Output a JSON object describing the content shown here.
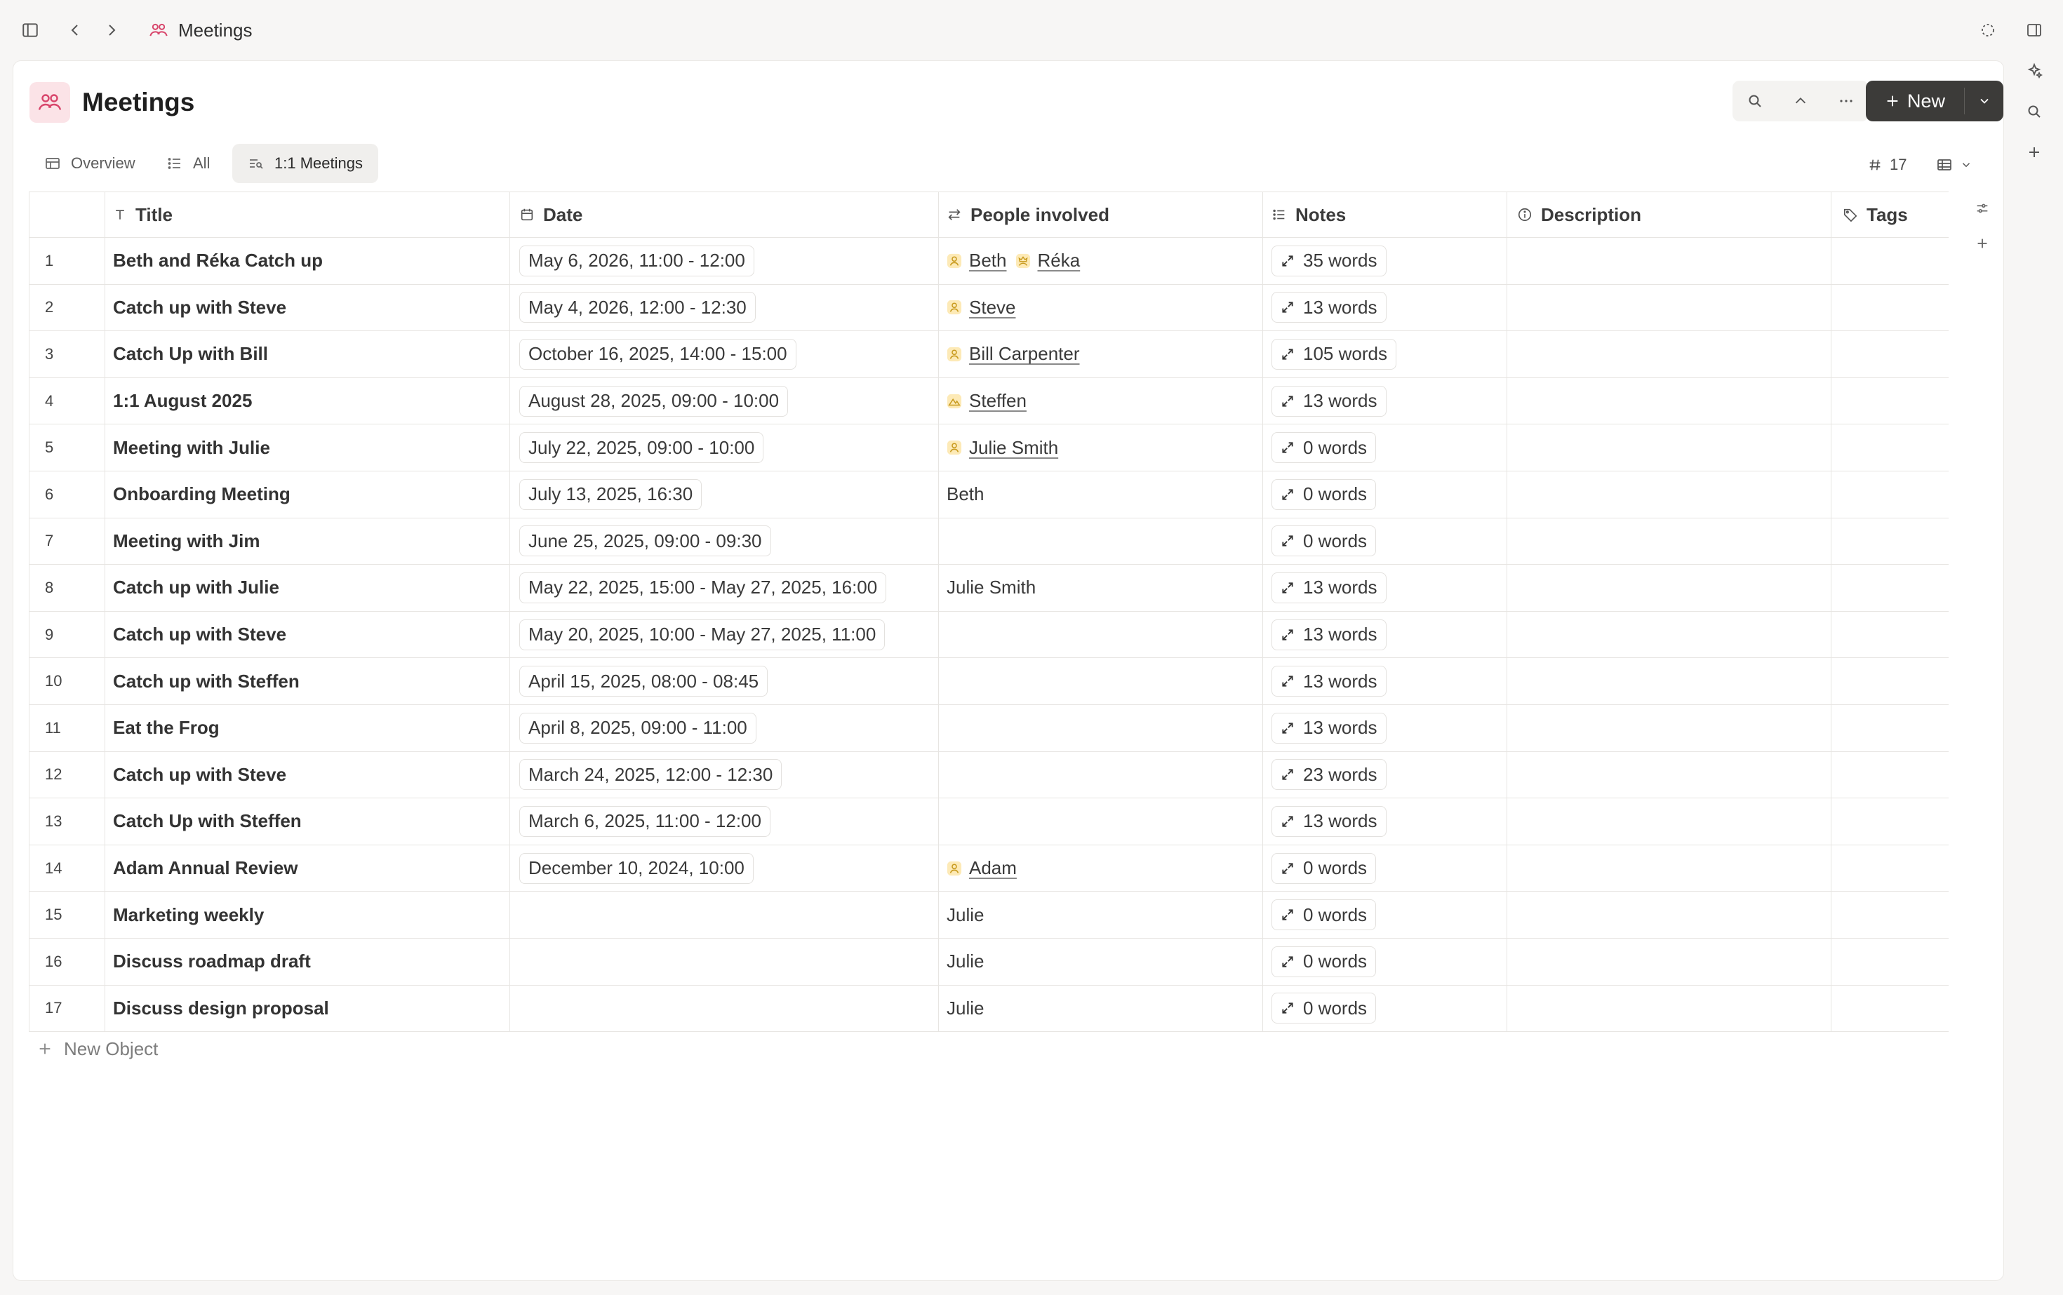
{
  "breadcrumb": {
    "title": "Meetings"
  },
  "header": {
    "title": "Meetings",
    "new_label": "New"
  },
  "tabs": [
    {
      "label": "Overview",
      "icon": "table-icon"
    },
    {
      "label": "All",
      "icon": "list-icon"
    },
    {
      "label": "1:1 Meetings",
      "icon": "filter-list-icon",
      "active": true
    }
  ],
  "object_count": "17",
  "columns": {
    "title": "Title",
    "date": "Date",
    "people": "People involved",
    "notes": "Notes",
    "description": "Description",
    "tags": "Tags"
  },
  "rows": [
    {
      "num": "1",
      "title": "Beth and Réka Catch up",
      "date": "May 6, 2026, 11:00 - 12:00",
      "people": [
        {
          "name": "Beth",
          "icon": "person-icon",
          "linked": true
        },
        {
          "name": "Réka",
          "icon": "crown-person-icon",
          "linked": true
        }
      ],
      "notes": "35 words"
    },
    {
      "num": "2",
      "title": "Catch up with Steve",
      "date": "May 4, 2026, 12:00 - 12:30",
      "people": [
        {
          "name": "Steve",
          "icon": "person-icon",
          "linked": true
        }
      ],
      "notes": "13 words"
    },
    {
      "num": "3",
      "title": "Catch Up with Bill",
      "date": "October 16, 2025, 14:00 - 15:00",
      "people": [
        {
          "name": "Bill Carpenter",
          "icon": "person-icon",
          "linked": true
        }
      ],
      "notes": "105 words"
    },
    {
      "num": "4",
      "title": "1:1 August 2025",
      "date": "August 28, 2025, 09:00 - 10:00",
      "people": [
        {
          "name": "Steffen",
          "icon": "mountain-icon",
          "linked": true
        }
      ],
      "notes": "13 words"
    },
    {
      "num": "5",
      "title": "Meeting with Julie",
      "date": "July 22, 2025, 09:00 - 10:00",
      "people": [
        {
          "name": "Julie Smith",
          "icon": "person-icon",
          "linked": true
        }
      ],
      "notes": "0 words"
    },
    {
      "num": "6",
      "title": "Onboarding Meeting",
      "date": "July 13, 2025, 16:30",
      "people": [
        {
          "name": "Beth",
          "linked": false
        }
      ],
      "notes": "0 words"
    },
    {
      "num": "7",
      "title": "Meeting with Jim",
      "date": "June 25, 2025, 09:00 - 09:30",
      "people": [],
      "notes": "0 words"
    },
    {
      "num": "8",
      "title": "Catch up with Julie",
      "date": "May 22, 2025, 15:00 - May 27, 2025, 16:00",
      "people": [
        {
          "name": "Julie Smith",
          "linked": false
        }
      ],
      "notes": "13 words"
    },
    {
      "num": "9",
      "title": "Catch up with Steve",
      "date": "May 20, 2025, 10:00 - May 27, 2025, 11:00",
      "people": [],
      "notes": "13 words"
    },
    {
      "num": "10",
      "title": "Catch up with Steffen",
      "date": "April 15, 2025, 08:00 - 08:45",
      "people": [],
      "notes": "13 words"
    },
    {
      "num": "11",
      "title": "Eat the Frog",
      "date": "April 8, 2025, 09:00 - 11:00",
      "people": [],
      "notes": "13 words"
    },
    {
      "num": "12",
      "title": "Catch up with Steve",
      "date": "March 24, 2025, 12:00 - 12:30",
      "people": [],
      "notes": "23 words"
    },
    {
      "num": "13",
      "title": "Catch Up with Steffen",
      "date": "March 6, 2025, 11:00 - 12:00",
      "people": [],
      "notes": "13 words"
    },
    {
      "num": "14",
      "title": "Adam Annual Review",
      "date": "December 10, 2024, 10:00",
      "people": [
        {
          "name": "Adam",
          "icon": "person-icon",
          "linked": true
        }
      ],
      "notes": "0 words"
    },
    {
      "num": "15",
      "title": "Marketing weekly",
      "date": "",
      "people": [
        {
          "name": "Julie",
          "linked": false
        }
      ],
      "notes": "0 words"
    },
    {
      "num": "16",
      "title": "Discuss roadmap draft",
      "date": "",
      "people": [
        {
          "name": "Julie",
          "linked": false
        }
      ],
      "notes": "0 words"
    },
    {
      "num": "17",
      "title": "Discuss design proposal",
      "date": "",
      "people": [
        {
          "name": "Julie",
          "linked": false
        }
      ],
      "notes": "0 words"
    }
  ],
  "new_object_label": "New Object",
  "colors": {
    "accent_pink": "#d8456b",
    "icon_bg_pink": "#fbe3e7",
    "person_icon_bg": "#fdeab7",
    "new_button_bg": "#3c3b39"
  }
}
